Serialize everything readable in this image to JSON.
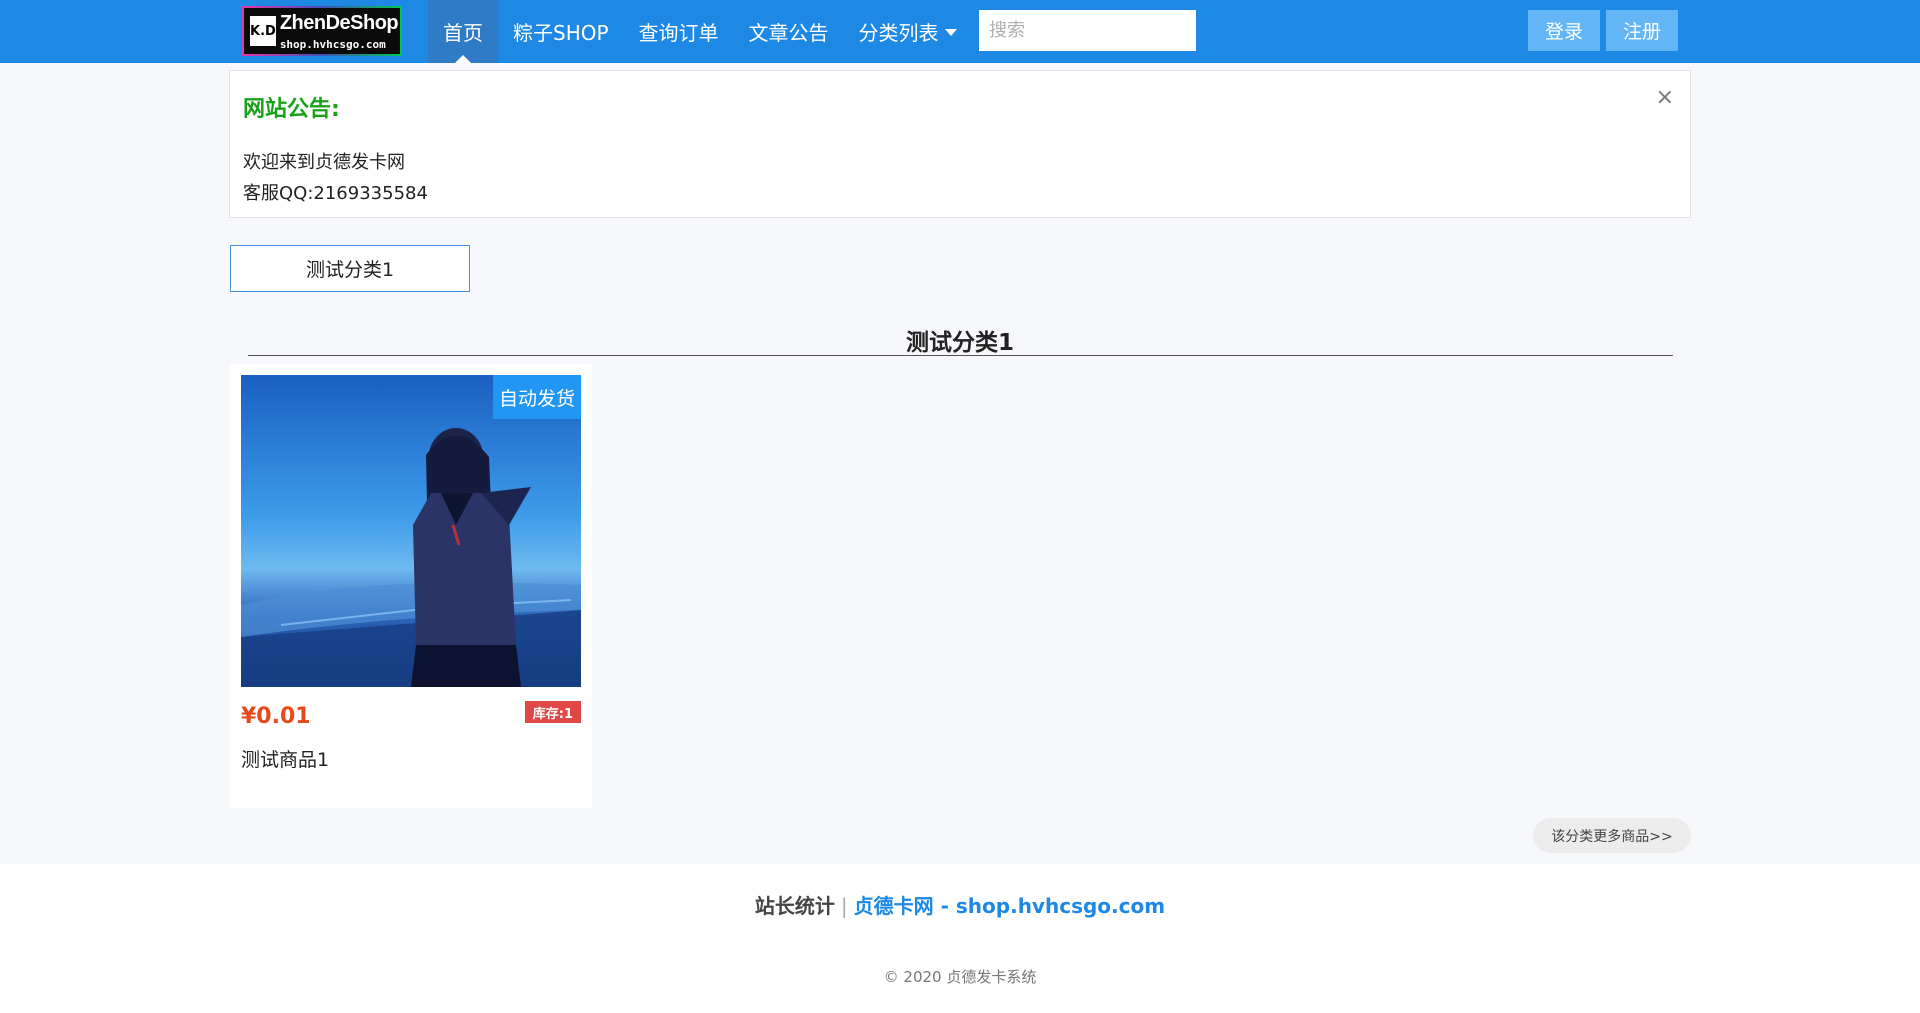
{
  "navbar": {
    "logo": {
      "title": "ZhenDeShop",
      "subtitle": "shop.hvhcsgo.com",
      "mark": "K.D"
    },
    "items": [
      {
        "label": "首页",
        "active": true
      },
      {
        "label": "粽子SHOP"
      },
      {
        "label": "查询订单"
      },
      {
        "label": "文章公告"
      },
      {
        "label": "分类列表"
      }
    ],
    "search_placeholder": "搜索",
    "login_label": "登录",
    "register_label": "注册",
    "colors": {
      "bar": "#1e88e5",
      "active": "#2f7bc6",
      "button": "#64b5f6"
    }
  },
  "notice": {
    "title": "网站公告:",
    "close_icon": "×",
    "lines": [
      "欢迎来到贞德发卡网",
      "客服QQ:2169335584"
    ],
    "title_color": "#1aa31a"
  },
  "categories": {
    "tabs": [
      {
        "label": "测试分类1"
      }
    ],
    "section_title": "测试分类1"
  },
  "products": [
    {
      "badge": "自动发货",
      "price": "¥0.01",
      "stock": "库存:1",
      "name": "测试商品1",
      "price_color": "#e64a19",
      "stock_color": "#e04848"
    }
  ],
  "more_link": "该分类更多商品>>",
  "footer": {
    "stats_label": "站长统计",
    "separator": "|",
    "site_link": "贞德卡网 - shop.hvhcsgo.com",
    "copyright": "© 2020 贞德发卡系统"
  }
}
